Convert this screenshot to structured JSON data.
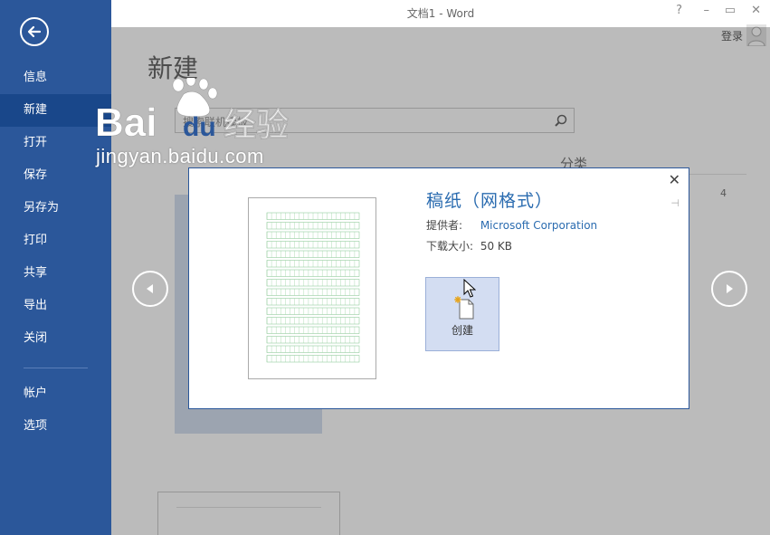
{
  "window": {
    "title": "文档1 - Word",
    "help": "?",
    "minimize": "–",
    "maximize": "▭",
    "close": "✕",
    "login": "登录"
  },
  "sidebar": {
    "items": [
      {
        "label": "信息"
      },
      {
        "label": "新建",
        "active": true
      },
      {
        "label": "打开"
      },
      {
        "label": "保存"
      },
      {
        "label": "另存为"
      },
      {
        "label": "打印"
      },
      {
        "label": "共享"
      },
      {
        "label": "导出"
      },
      {
        "label": "关闭"
      }
    ],
    "bottom_items": [
      {
        "label": "帐户"
      },
      {
        "label": "选项"
      }
    ]
  },
  "main": {
    "title": "新建",
    "search_placeholder": "搜索联机模板",
    "category_heading": "分类",
    "category_count": "4"
  },
  "dialog": {
    "title": "稿纸（网格式）",
    "provider_label": "提供者:",
    "provider_value": "Microsoft Corporation",
    "size_label": "下载大小:",
    "size_value": "50 KB",
    "create_label": "创建",
    "close": "✕",
    "pin": "⊣"
  },
  "watermark": {
    "brand": "Baidu经验",
    "url": "jingyan.baidu.com"
  },
  "colors": {
    "accent": "#2b579a",
    "link": "#2b6cb0",
    "create_bg": "#d3ddf2"
  }
}
